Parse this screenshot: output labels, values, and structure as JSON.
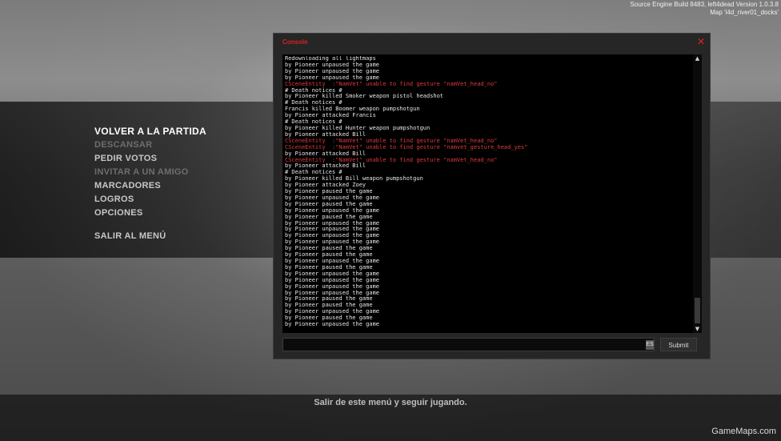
{
  "engine_info": {
    "line1": "Source Engine Build 8483, left4dead Version 1.0.3.8",
    "line2": "Map 'l4d_river01_docks'"
  },
  "menu": {
    "items": [
      {
        "label": "VOLVER A LA PARTIDA",
        "state": "active"
      },
      {
        "label": "DESCANSAR",
        "state": "disabled"
      },
      {
        "label": "PEDIR VOTOS",
        "state": "enabled"
      },
      {
        "label": "INVITAR A UN AMIGO",
        "state": "disabled"
      },
      {
        "label": "MARCADORES",
        "state": "enabled"
      },
      {
        "label": "LOGROS",
        "state": "enabled"
      },
      {
        "label": "OPCIONES",
        "state": "enabled"
      }
    ],
    "exit_label": "SALIR AL MENÚ"
  },
  "console": {
    "title": "Console",
    "close_glyph": "✕",
    "input_value": "",
    "lang_indicator": "ES",
    "submit_label": "Submit",
    "scroll_up_glyph": "▲",
    "scroll_down_glyph": "▼",
    "lines": [
      {
        "text": "Redownloading all lightmaps",
        "type": "normal"
      },
      {
        "text": "by Pioneer unpaused the game",
        "type": "normal"
      },
      {
        "text": "by Pioneer unpaused the game",
        "type": "normal"
      },
      {
        "text": "by Pioneer unpaused the game",
        "type": "normal"
      },
      {
        "text": "CSceneEntity  :\"NamVet\" unable to find gesture \"namVet_head_no\"",
        "type": "error"
      },
      {
        "text": "# Death notices #",
        "type": "normal"
      },
      {
        "text": "by Pioneer killed Smoker weapon pistol headshot",
        "type": "normal"
      },
      {
        "text": "# Death notices #",
        "type": "normal"
      },
      {
        "text": "Francis killed Boomer weapon pumpshotgun",
        "type": "normal"
      },
      {
        "text": "by Pioneer attacked Francis",
        "type": "normal"
      },
      {
        "text": "# Death notices #",
        "type": "normal"
      },
      {
        "text": "by Pioneer killed Hunter weapon pumpshotgun",
        "type": "normal"
      },
      {
        "text": "by Pioneer attacked Bill",
        "type": "normal"
      },
      {
        "text": "CSceneEntity  :\"NamVet\" unable to find gesture \"namVet_head_no\"",
        "type": "error"
      },
      {
        "text": "CSceneEntity  :\"NamVet\" unable to find gesture \"namvet_gesture_head_yes\"",
        "type": "error"
      },
      {
        "text": "by Pioneer attacked Bill",
        "type": "normal"
      },
      {
        "text": "CSceneEntity  :\"NamVet\" unable to find gesture \"namVet_head_no\"",
        "type": "error"
      },
      {
        "text": "by Pioneer attacked Bill",
        "type": "normal"
      },
      {
        "text": "# Death notices #",
        "type": "normal"
      },
      {
        "text": "by Pioneer killed Bill weapon pumpshotgun",
        "type": "normal"
      },
      {
        "text": "by Pioneer attacked Zoey",
        "type": "normal"
      },
      {
        "text": "by Pioneer paused the game",
        "type": "normal"
      },
      {
        "text": "by Pioneer unpaused the game",
        "type": "normal"
      },
      {
        "text": "by Pioneer paused the game",
        "type": "normal"
      },
      {
        "text": "by Pioneer unpaused the game",
        "type": "normal"
      },
      {
        "text": "by Pioneer paused the game",
        "type": "normal"
      },
      {
        "text": "by Pioneer unpaused the game",
        "type": "normal"
      },
      {
        "text": "by Pioneer unpaused the game",
        "type": "normal"
      },
      {
        "text": "by Pioneer unpaused the game",
        "type": "normal"
      },
      {
        "text": "by Pioneer unpaused the game",
        "type": "normal"
      },
      {
        "text": "by Pioneer paused the game",
        "type": "normal"
      },
      {
        "text": "by Pioneer paused the game",
        "type": "normal"
      },
      {
        "text": "by Pioneer unpaused the game",
        "type": "normal"
      },
      {
        "text": "by Pioneer paused the game",
        "type": "normal"
      },
      {
        "text": "by Pioneer unpaused the game",
        "type": "normal"
      },
      {
        "text": "by Pioneer unpaused the game",
        "type": "normal"
      },
      {
        "text": "by Pioneer unpaused the game",
        "type": "normal"
      },
      {
        "text": "by Pioneer unpaused the game",
        "type": "normal"
      },
      {
        "text": "by Pioneer paused the game",
        "type": "normal"
      },
      {
        "text": "by Pioneer paused the game",
        "type": "normal"
      },
      {
        "text": "by Pioneer unpaused the game",
        "type": "normal"
      },
      {
        "text": "by Pioneer paused the game",
        "type": "normal"
      },
      {
        "text": "by Pioneer unpaused the game",
        "type": "normal"
      }
    ]
  },
  "footer": {
    "hint": "Salir de este menú y seguir jugando.",
    "watermark": "GameMaps.com"
  },
  "colors": {
    "console_error": "#e03a3a",
    "console_title": "#d82020"
  }
}
